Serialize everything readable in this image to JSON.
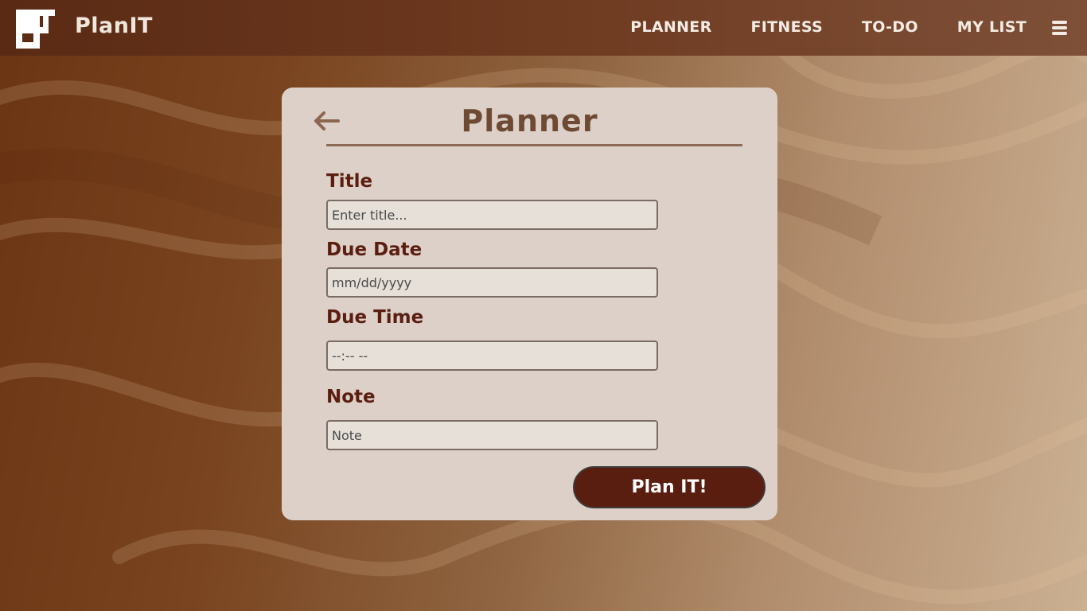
{
  "app": {
    "brand": "PlanIT"
  },
  "nav": {
    "links": [
      "PLANNER",
      "FITNESS",
      "TO-DO",
      "MY LIST"
    ]
  },
  "icons": {
    "logo": "planit-logo-icon",
    "menu": "hamburger-menu-icon",
    "back": "back-arrow-icon"
  },
  "colors": {
    "navbar": "#6e3a20",
    "card": "#ddd0c8",
    "label": "#5a1e10",
    "title": "#6e4a34",
    "button": "#5a1e10",
    "input_bg": "#e6e0d8"
  },
  "planner": {
    "title": "Planner",
    "fields": {
      "title": {
        "label": "Title",
        "placeholder": "Enter title...",
        "value": ""
      },
      "due_date": {
        "label": "Due Date",
        "placeholder": "mm/dd/yyyy",
        "value": ""
      },
      "due_time": {
        "label": "Due Time",
        "placeholder": "--:-- --",
        "value": ""
      },
      "note": {
        "label": "Note",
        "placeholder": "Note",
        "value": ""
      }
    },
    "submit_label": "Plan IT!"
  }
}
